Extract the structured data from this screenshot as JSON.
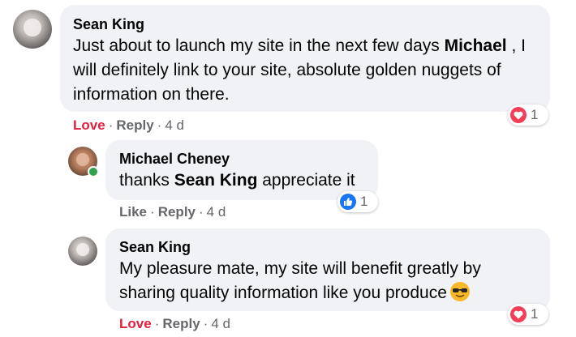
{
  "comments": [
    {
      "author": "Sean King",
      "text_before": "Just about to launch my site in the next few days ",
      "mention": "Michael",
      "text_after": " , I will definitely link to your site, absolute golden nuggets of information on there.",
      "reaction": {
        "type": "love",
        "count": "1"
      },
      "action_primary": "Love",
      "action_reply": "Reply",
      "time": "4 d"
    },
    {
      "author": "Michael Cheney",
      "text_before": "thanks ",
      "mention": "Sean King",
      "text_after": " appreciate it",
      "reaction": {
        "type": "like",
        "count": "1"
      },
      "action_primary": "Like",
      "action_reply": "Reply",
      "time": "4 d",
      "online": true
    },
    {
      "author": "Sean King",
      "text": "My pleasure mate, my site will benefit greatly by sharing quality information like you produce",
      "emoji": "sunglasses-emoji",
      "reaction": {
        "type": "love",
        "count": "1"
      },
      "action_primary": "Love",
      "action_reply": "Reply",
      "time": "4 d"
    }
  ],
  "separator": "·",
  "colors": {
    "bubble": "#f0f2f5",
    "love": "#e41e3f",
    "like": "#1877f2",
    "meta": "#65676b",
    "online": "#31a24c"
  }
}
